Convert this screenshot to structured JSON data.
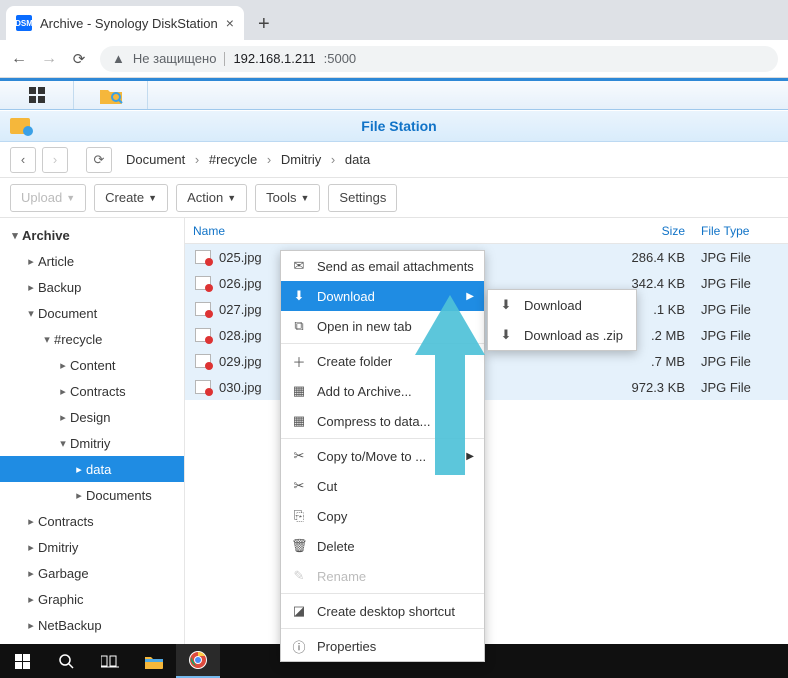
{
  "browser": {
    "tab_title": "Archive - Synology DiskStation",
    "warning_text": "Не защищено",
    "host": "192.168.1.211",
    "port": ":5000"
  },
  "filestation": {
    "title": "File Station",
    "breadcrumb": [
      "Document",
      "#recycle",
      "Dmitriy",
      "data"
    ],
    "toolbar": {
      "upload": "Upload",
      "create": "Create",
      "action": "Action",
      "tools": "Tools",
      "settings": "Settings"
    },
    "columns": {
      "name": "Name",
      "size": "Size",
      "type": "File Type"
    },
    "tree": [
      {
        "label": "Archive",
        "level": 1,
        "expanded": true,
        "root": true
      },
      {
        "label": "Article",
        "level": 2,
        "expanded": false
      },
      {
        "label": "Backup",
        "level": 2,
        "expanded": false
      },
      {
        "label": "Document",
        "level": 2,
        "expanded": true
      },
      {
        "label": "#recycle",
        "level": 3,
        "expanded": true
      },
      {
        "label": "Content",
        "level": 4,
        "expanded": false
      },
      {
        "label": "Contracts",
        "level": 4,
        "expanded": false
      },
      {
        "label": "Design",
        "level": 4,
        "expanded": false
      },
      {
        "label": "Dmitriy",
        "level": 4,
        "expanded": true
      },
      {
        "label": "data",
        "level": 5,
        "expanded": false,
        "selected": true
      },
      {
        "label": "Documents",
        "level": 5,
        "expanded": false
      },
      {
        "label": "Contracts",
        "level": 2,
        "expanded": false
      },
      {
        "label": "Dmitriy",
        "level": 2,
        "expanded": false
      },
      {
        "label": "Garbage",
        "level": 2,
        "expanded": false
      },
      {
        "label": "Graphic",
        "level": 2,
        "expanded": false
      },
      {
        "label": "NetBackup",
        "level": 2,
        "expanded": false
      }
    ],
    "files": [
      {
        "name": "025.jpg",
        "size": "286.4 KB",
        "type": "JPG File",
        "selected": true
      },
      {
        "name": "026.jpg",
        "size": "342.4 KB",
        "type": "JPG File",
        "selected": true
      },
      {
        "name": "027.jpg",
        "size_suffix": ".1 KB",
        "type": "JPG File",
        "selected": true
      },
      {
        "name": "028.jpg",
        "size_suffix": ".2 MB",
        "type": "JPG File",
        "selected": true
      },
      {
        "name": "029.jpg",
        "size_suffix": ".7 MB",
        "type": "JPG File",
        "selected": true
      },
      {
        "name": "030.jpg",
        "size": "972.3 KB",
        "type": "JPG File",
        "selected": true
      }
    ],
    "context_menu": [
      {
        "label": "Send as email attachments",
        "icon": "✉"
      },
      {
        "label": "Download",
        "icon": "⬇",
        "highlight": true,
        "submenu": true
      },
      {
        "label": "Open in new tab",
        "icon": "⧉"
      },
      {
        "sep": true
      },
      {
        "label": "Create folder",
        "icon": "＋"
      },
      {
        "label": "Add to Archive...",
        "icon": "▦"
      },
      {
        "label": "Compress to data...",
        "icon": "▦"
      },
      {
        "sep": true
      },
      {
        "label": "Copy to/Move to ...",
        "icon": "✂",
        "submenu": true
      },
      {
        "label": "Cut",
        "icon": "✂"
      },
      {
        "label": "Copy",
        "icon": "⎘"
      },
      {
        "label": "Delete",
        "icon": "🗑"
      },
      {
        "label": "Rename",
        "icon": "✎",
        "disabled": true
      },
      {
        "sep": true
      },
      {
        "label": "Create desktop shortcut",
        "icon": "◪"
      },
      {
        "sep": true
      },
      {
        "label": "Properties",
        "icon": "ⓘ"
      }
    ],
    "submenu": [
      {
        "label": "Download",
        "icon": "⬇"
      },
      {
        "label": "Download as .zip",
        "icon": "⬇"
      }
    ]
  },
  "colors": {
    "accent": "#1f8ce3",
    "link": "#1173c7",
    "arrow": "#4ec1d8"
  }
}
